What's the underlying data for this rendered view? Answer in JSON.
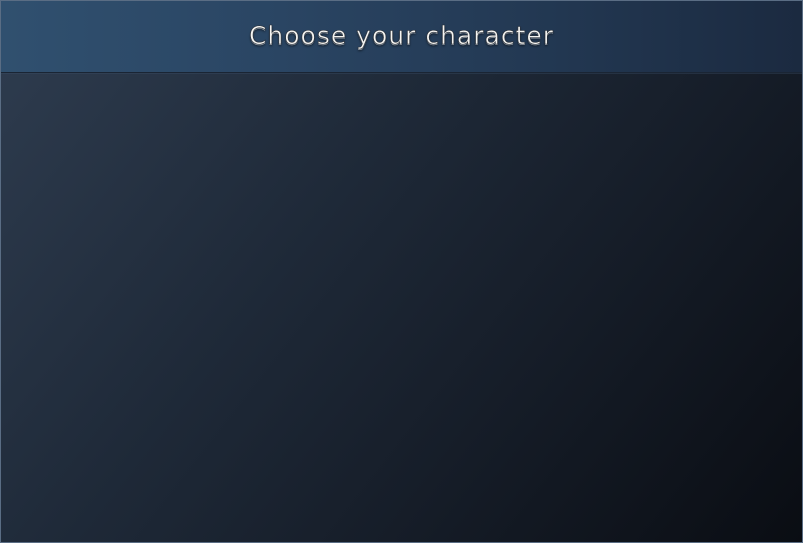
{
  "screen": {
    "title": "Choose your character"
  },
  "colors": {
    "header_gradient_start": "#30506f",
    "header_gradient_end": "#1b2a40",
    "background_top_left": "#2f3d50",
    "background_bottom_right": "#0a0d13",
    "title_text": "#f4f4f2",
    "frame_border": "#5a6d84"
  }
}
